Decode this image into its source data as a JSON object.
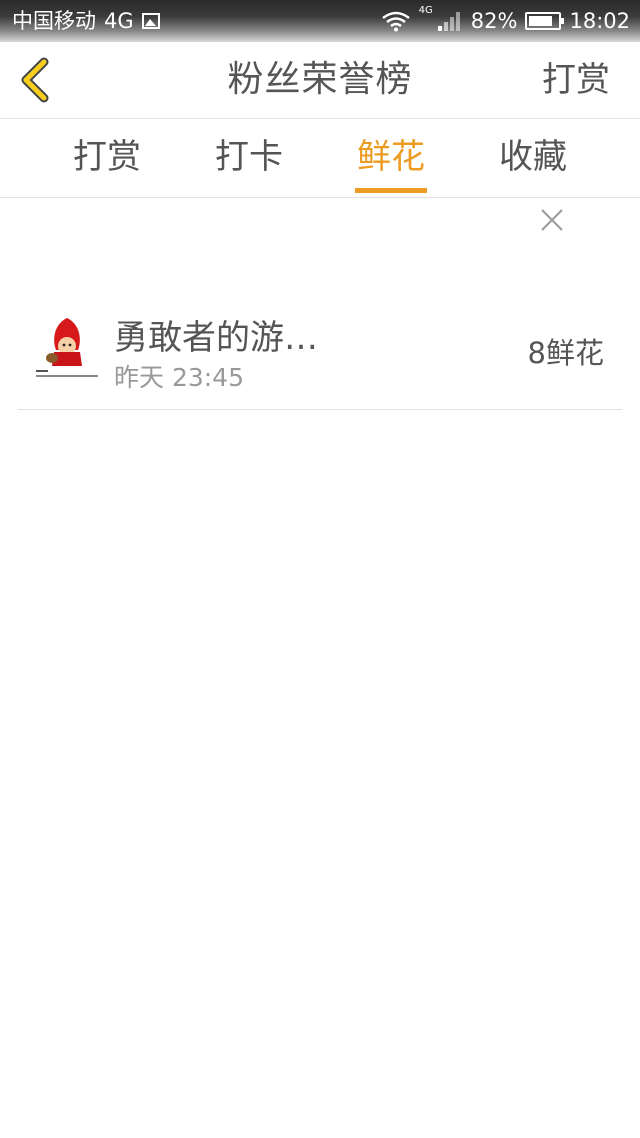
{
  "status_bar": {
    "carrier": "中国移动",
    "network": "4G",
    "network_tag": "4G",
    "battery": "82%",
    "battery_level": 0.82,
    "time": "18:02",
    "icons": [
      "picture-icon",
      "wifi-icon",
      "cell-signal-icon",
      "battery-icon"
    ]
  },
  "header": {
    "back_icon": "chevron-left-icon",
    "title": "粉丝荣誉榜",
    "action_label": "打赏"
  },
  "tabs": [
    {
      "label": "打赏",
      "active": false
    },
    {
      "label": "打卡",
      "active": false
    },
    {
      "label": "鲜花",
      "active": true
    },
    {
      "label": "收藏",
      "active": false
    }
  ],
  "close_icon": "close-icon",
  "list": [
    {
      "avatar": "avatar-red-hood-cartoon",
      "name": "勇敢者的游…",
      "time": "昨天 23:45",
      "count": "8鲜花"
    }
  ],
  "colors": {
    "accent": "#ec9c22",
    "text": "#555555",
    "muted": "#999999",
    "back_arrow_yellow": "#f6cf1d"
  }
}
